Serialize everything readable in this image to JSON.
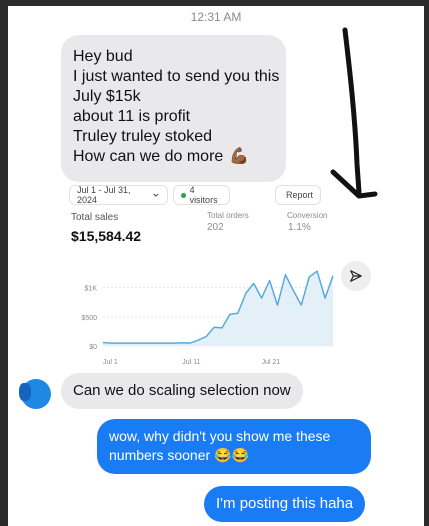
{
  "status": {
    "time": "12:31 AM"
  },
  "incoming_message_1": {
    "lines": [
      "Hey bud",
      "I just wanted to send you this",
      "July $15k",
      "about 11 is profit",
      "Truley truley stoked",
      "How can we do more"
    ],
    "emoji": "💪🏾"
  },
  "analytics_card": {
    "date_range": "Jul 1 - Jul 31, 2024",
    "visitors": "4 visitors",
    "report_label": "Report",
    "total_sales_label": "Total sales",
    "total_sales_value": "$15,584.42",
    "total_orders_label": "Total orders",
    "total_orders_value": "202",
    "conversion_label": "Conversion",
    "conversion_value": "1.1%"
  },
  "chart_data": {
    "type": "line",
    "x_ticks": [
      "Jul 1",
      "Jul 11",
      "Jul 21"
    ],
    "y_ticks": [
      "$1K",
      "$500",
      "$0"
    ],
    "ylim": [
      0,
      1300
    ],
    "series": [
      {
        "color": "#5aaad9",
        "values": [
          60,
          50,
          50,
          50,
          50,
          50,
          50,
          50,
          50,
          50,
          55,
          50,
          100,
          160,
          320,
          310,
          540,
          560,
          900,
          1070,
          820,
          1120,
          700,
          1220,
          950,
          700,
          1180,
          1280,
          820,
          1200
        ]
      }
    ]
  },
  "incoming_message_2": {
    "text": "Can we do scaling selection now"
  },
  "outgoing_message_1": {
    "line1": "wow, why didn't you show me these",
    "line2": "numbers sooner",
    "emoji": "😂😂"
  },
  "outgoing_message_2": {
    "text": "I'm posting this haha"
  },
  "icons": {
    "share": "send-icon",
    "arrow": "hand-drawn-arrow"
  }
}
